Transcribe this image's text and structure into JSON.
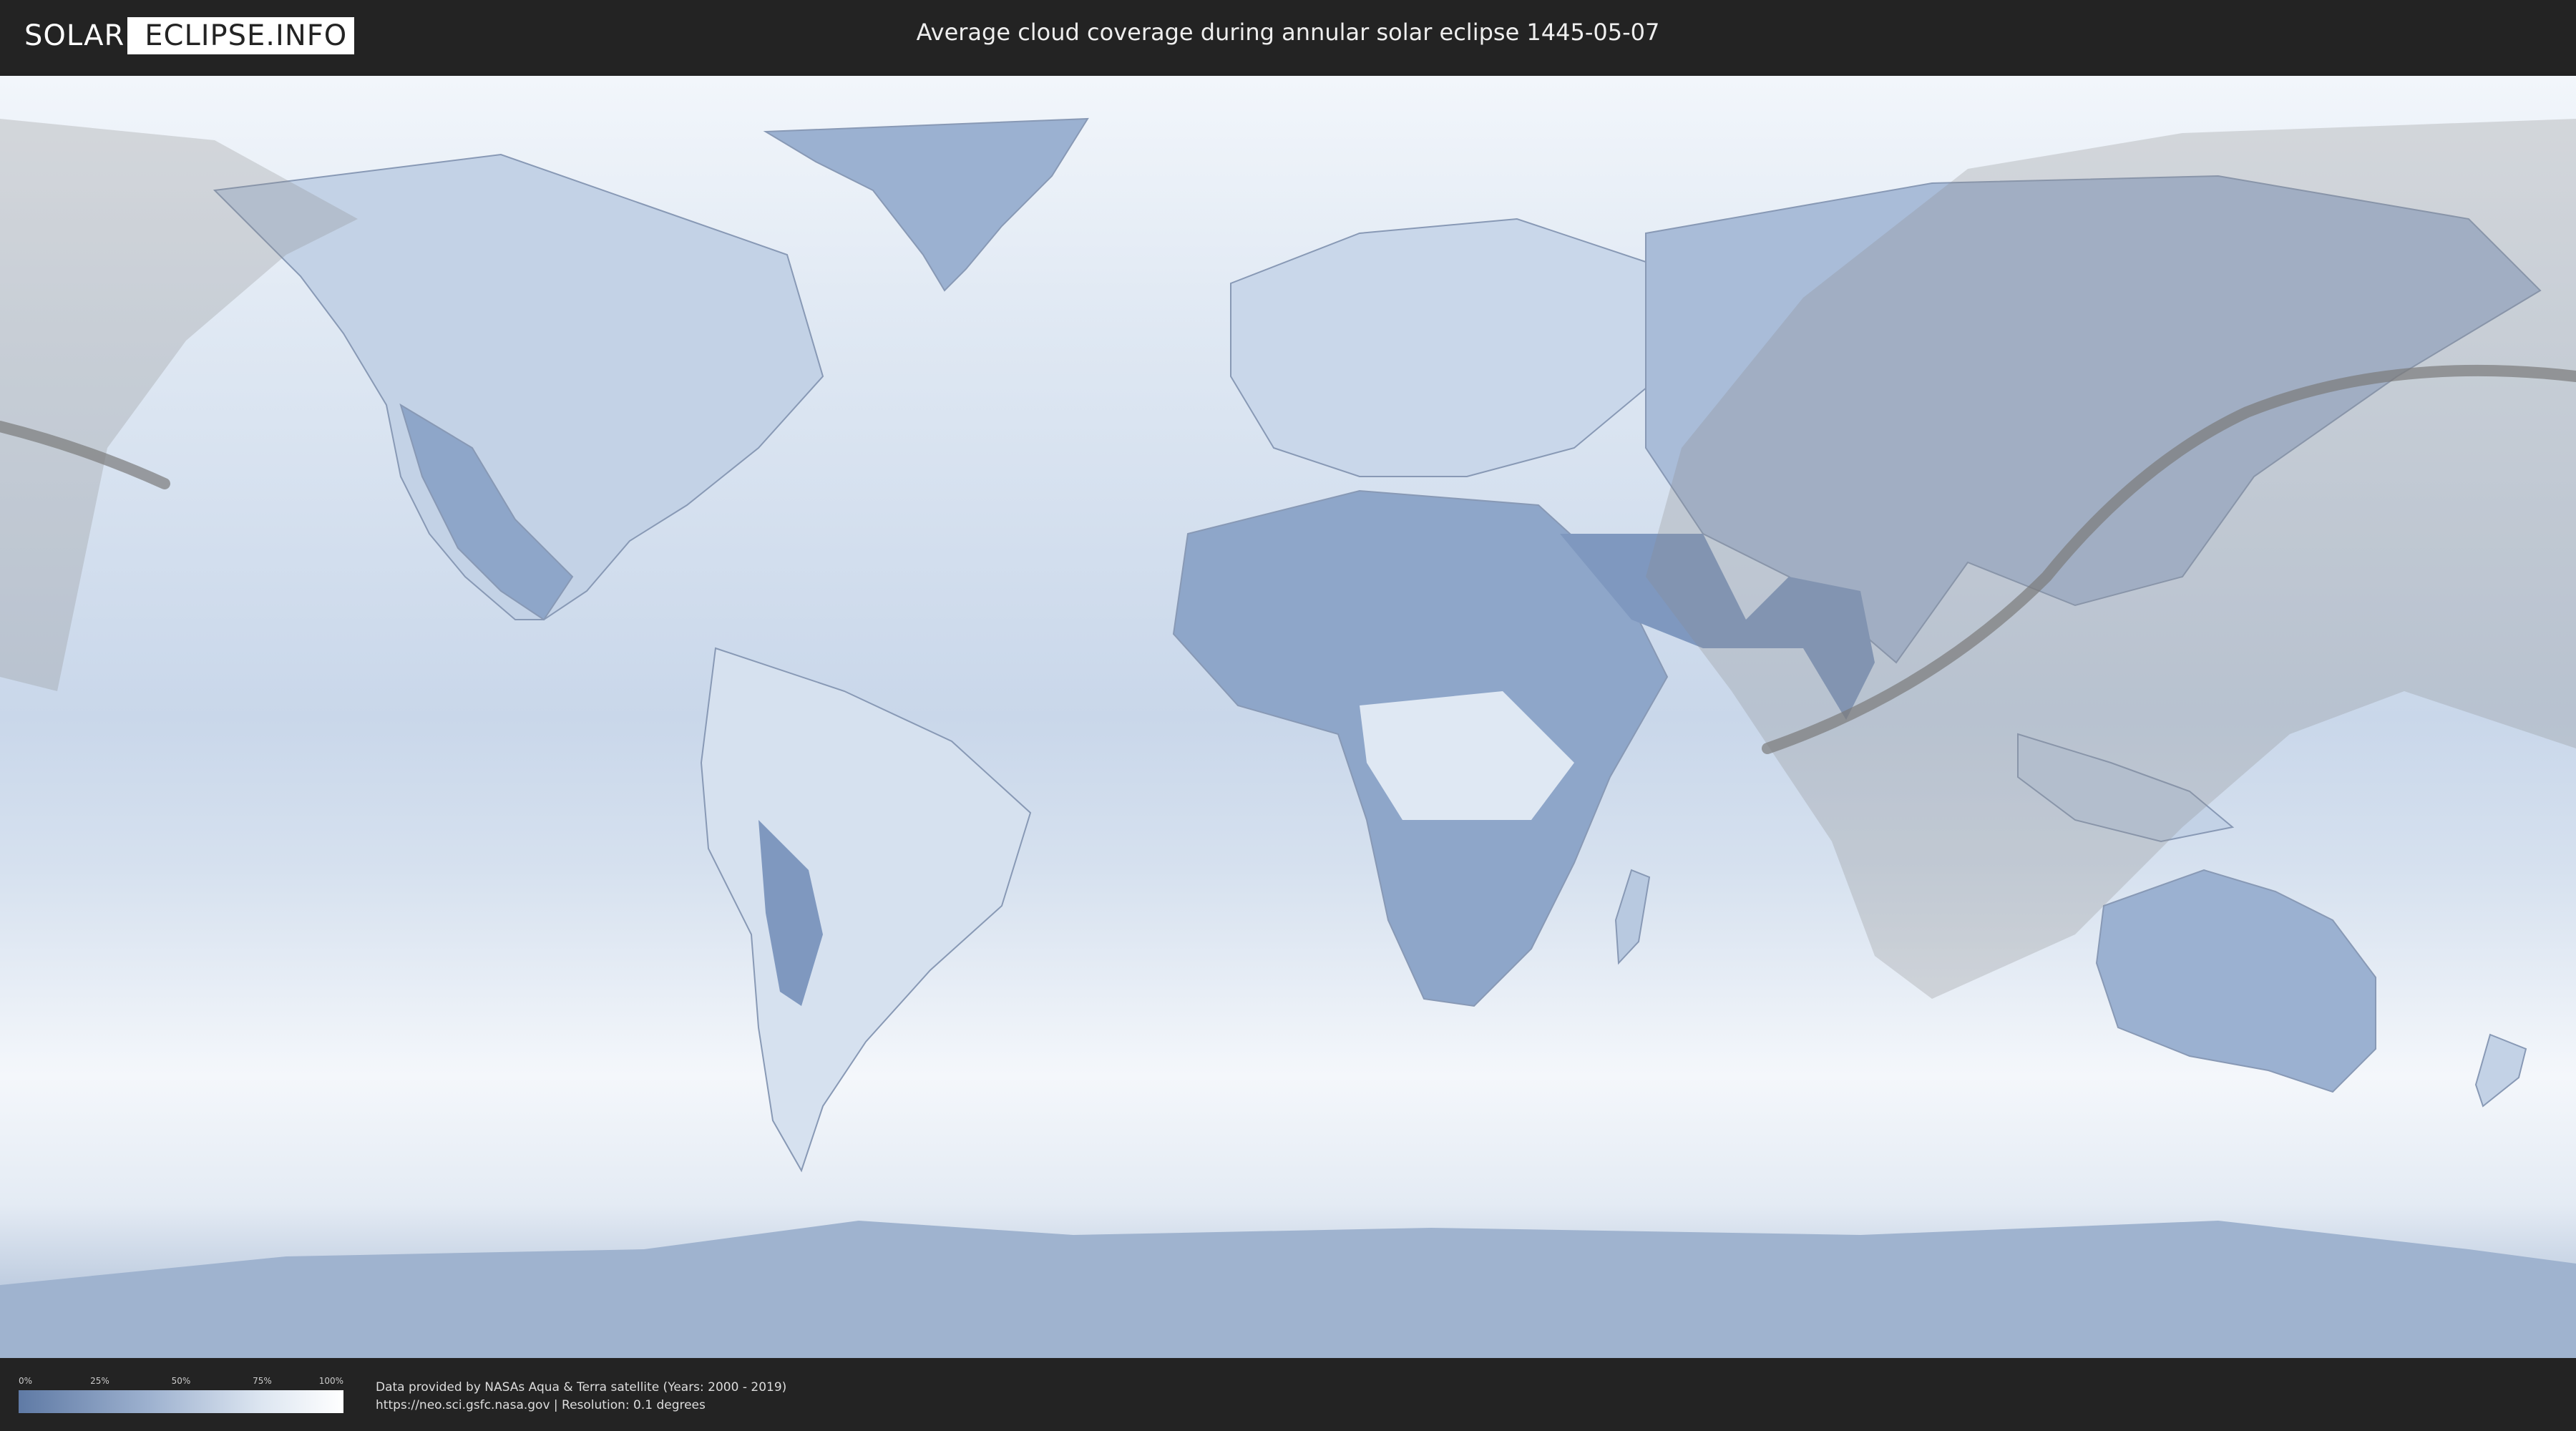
{
  "header": {
    "logo_left": "SOLAR",
    "logo_right": "ECLIPSE.INFO",
    "title": "Average cloud coverage during annular solar eclipse 1445-05-07"
  },
  "legend": {
    "ticks": [
      {
        "label": "0%",
        "value": 0
      },
      {
        "label": "25%",
        "value": 25
      },
      {
        "label": "50%",
        "value": 50
      },
      {
        "label": "75%",
        "value": 75
      },
      {
        "label": "100%",
        "value": 100
      }
    ],
    "colors": {
      "low": "#5f7aa5",
      "high": "#ffffff"
    }
  },
  "credits": {
    "line1": "Data provided by NASAs Aqua & Terra satellite (Years: 2000 - 2019)",
    "line2": "https://neo.sci.gsfc.nasa.gov | Resolution: 0.1 degrees"
  },
  "colors": {
    "background": "#232323",
    "ocean_cloud": "#e8eef6",
    "clear_land": "#7f98bf",
    "eclipse_zone": "#9a9a9a",
    "eclipse_path": "#7a7a7a"
  }
}
